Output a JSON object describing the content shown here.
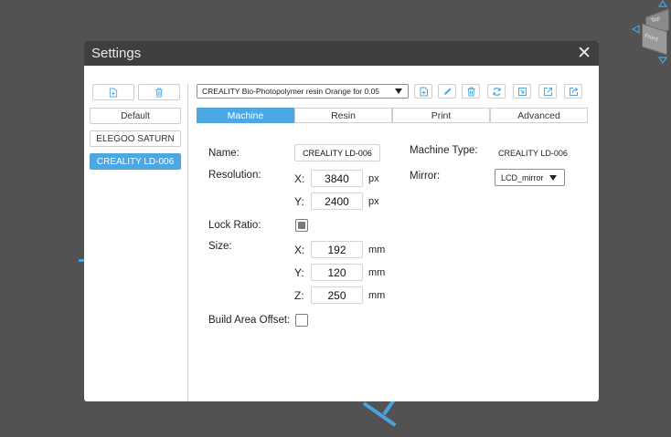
{
  "window": {
    "title": "Settings",
    "close_glyph": "✕"
  },
  "sidebar": {
    "tools": [
      {
        "icon": "new-file-icon"
      },
      {
        "icon": "trash-icon"
      }
    ],
    "profiles": [
      "Default",
      "ELEGOO SATURN",
      "CREALITY LD-006"
    ],
    "selected_profile": "CREALITY LD-006"
  },
  "toolbar": {
    "resin_profile": "CREALITY Bio-Photopolymer resin Orange for 0.05",
    "buttons": [
      "new-file-icon",
      "edit-icon",
      "trash-icon",
      "refresh-icon",
      "import-icon",
      "export-icon",
      "share-icon"
    ]
  },
  "tabs": [
    "Machine",
    "Resin",
    "Print",
    "Advanced"
  ],
  "active_tab": "Machine",
  "machine": {
    "name_label": "Name:",
    "name_value": "CREALITY LD-006",
    "resolution_label": "Resolution:",
    "res_x_axis": "X:",
    "res_x": "3840",
    "res_y_axis": "Y:",
    "res_y": "2400",
    "res_unit": "px",
    "lock_ratio_label": "Lock Ratio:",
    "lock_ratio_checked": true,
    "size_label": "Size:",
    "size_x_axis": "X:",
    "size_x": "192",
    "size_y_axis": "Y:",
    "size_y": "120",
    "size_z_axis": "Z:",
    "size_z": "250",
    "size_unit": "mm",
    "build_area_offset_label": "Build Area Offset:",
    "build_area_offset_checked": false,
    "machine_type_label": "Machine Type:",
    "machine_type_value": "CREALITY LD-006",
    "mirror_label": "Mirror:",
    "mirror_value": "LCD_mirror"
  },
  "viewcube": {
    "top_label": "Top",
    "front_label": "Front"
  },
  "colors": {
    "accent": "#4da7e3",
    "titlebar": "#3f3f3f",
    "background": "#525252"
  }
}
